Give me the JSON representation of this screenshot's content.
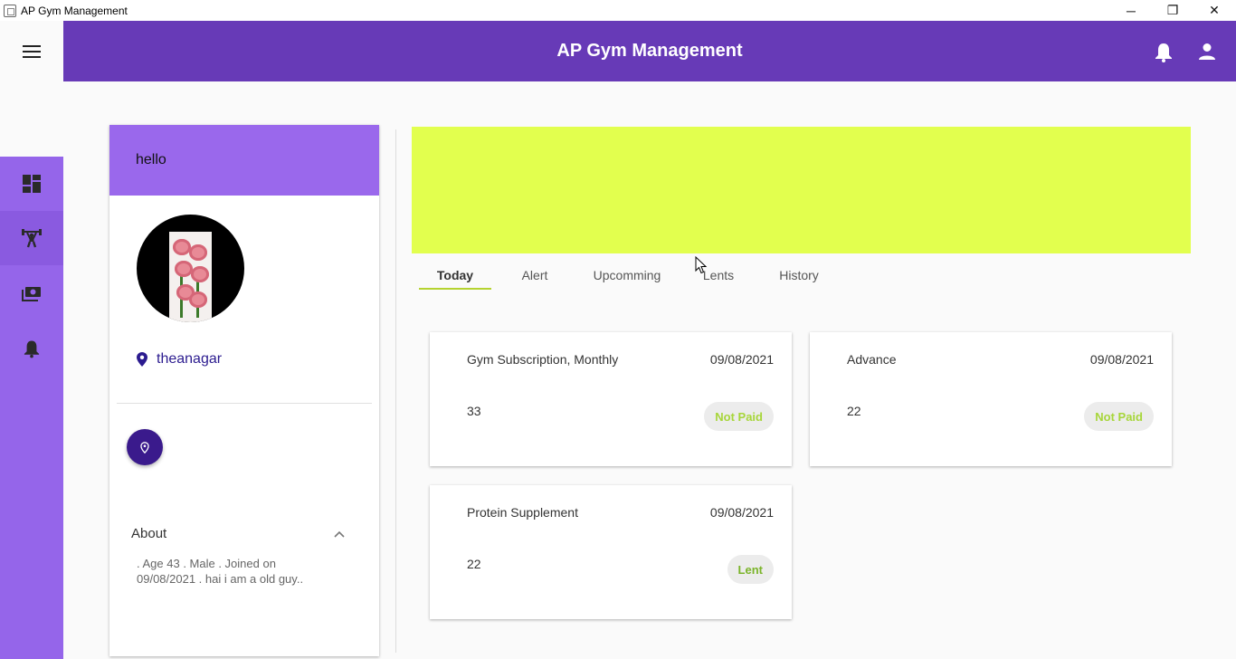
{
  "window": {
    "title": "AP Gym Management",
    "controls": {
      "minimize": "─",
      "maximize": "❐",
      "close": "✕"
    }
  },
  "appbar": {
    "title": "AP Gym Management",
    "icons": [
      "notifications-icon",
      "account-icon"
    ],
    "color": "#673ab7"
  },
  "rail": {
    "color": "#9565ea",
    "items": [
      {
        "icon": "dashboard-icon",
        "active": false
      },
      {
        "icon": "fitness-icon",
        "active": true
      },
      {
        "icon": "payments-icon",
        "active": false
      },
      {
        "icon": "notifications-icon",
        "active": false
      }
    ]
  },
  "profile": {
    "header": "hello",
    "location": "theanagar",
    "about_label": "About",
    "about_text": ". Age 43 . Male . Joined on 09/08/2021 . hai i am a old guy.."
  },
  "banner": {
    "color": "#e2ff4e"
  },
  "tabs": [
    {
      "label": "Today",
      "active": true
    },
    {
      "label": "Alert",
      "active": false
    },
    {
      "label": "Upcomming",
      "active": false
    },
    {
      "label": "Lents",
      "active": false
    },
    {
      "label": "History",
      "active": false
    }
  ],
  "payments": [
    {
      "item": "Gym Subscription, Monthly",
      "date": "09/08/2021",
      "amount": "33",
      "status": "Not Paid"
    },
    {
      "item": "Advance",
      "date": "09/08/2021",
      "amount": "22",
      "status": "Not Paid"
    },
    {
      "item": "Protein Supplement",
      "date": "09/08/2021",
      "amount": "22",
      "status": "Lent"
    }
  ]
}
